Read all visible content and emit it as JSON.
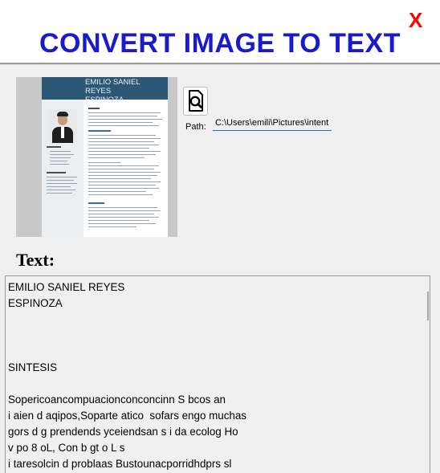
{
  "window": {
    "title": "CONVERT IMAGE TO TEXT",
    "close_label": "X",
    "close_color": "#ff0000",
    "title_color": "#1a1acc"
  },
  "preview": {
    "name_line1": "EMILIO SANIEL REYES",
    "name_line2": "ESPINOZA"
  },
  "toolbar": {
    "open_icon": "search-document-icon"
  },
  "path": {
    "label": "Path:",
    "value": "C:\\Users\\emili\\Pictures\\intent"
  },
  "result": {
    "label": "Text:",
    "content": "EMILIO SANIEL REYES\nESPINOZA\n\n\n\nSINTESIS\n\nSopericoancompuacionconconcinn S bcos an\ni aien d aqipos,Soparte atico  sofars engo muchas\ngors d g prendends yceiendsan s i da ecolog Ho\nv po 8 oL, Con b gt o L s\ni taresolcin d problaas Bustounacporridhdprs sl"
  }
}
